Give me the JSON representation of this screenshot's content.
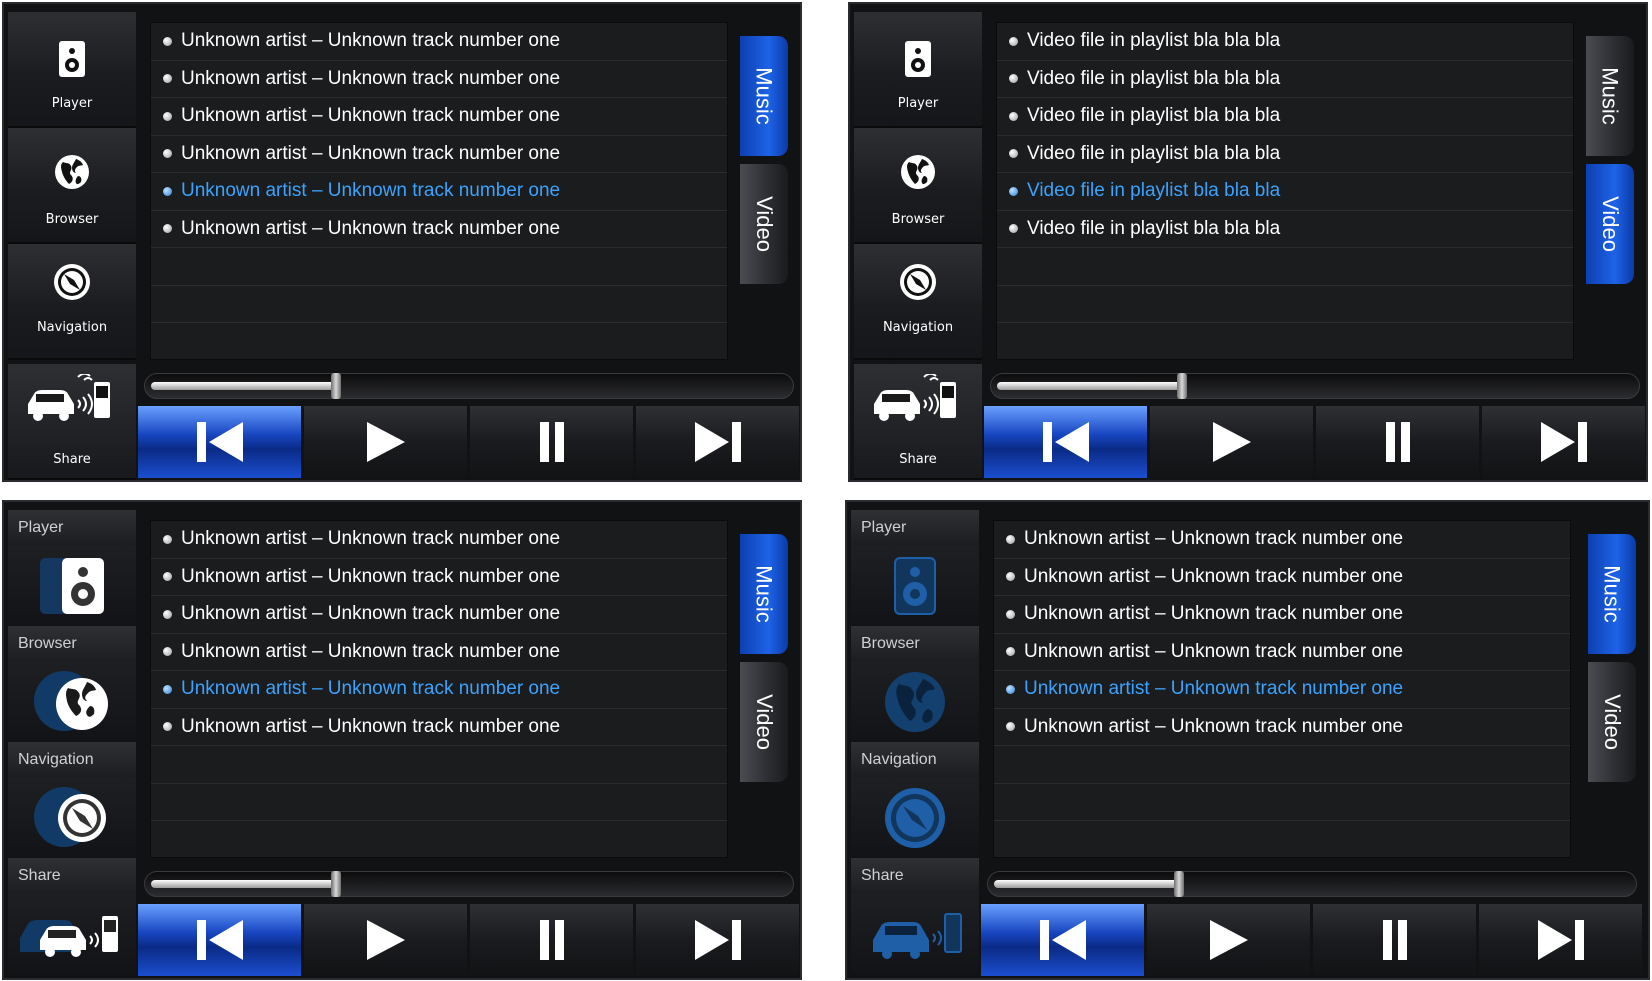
{
  "colors": {
    "accent": "#1e63e8",
    "highlight_text": "#3aa3ff",
    "background": "#111214"
  },
  "panels": [
    {
      "style": 1,
      "sidebar": {
        "player_label": "Player",
        "browser_label": "Browser",
        "navigation_label": "Navigation",
        "share_label": "Share"
      },
      "list": [
        "Unknown artist – Unknown track number one",
        "Unknown artist – Unknown track number one",
        "Unknown artist – Unknown track number one",
        "Unknown artist – Unknown track number one",
        "Unknown artist – Unknown track number one",
        "Unknown artist – Unknown track number one"
      ],
      "selected_index": 4,
      "tabs": {
        "music": "Music",
        "video": "Video",
        "active": "music"
      },
      "progress": 0.32
    },
    {
      "style": 1,
      "sidebar": {
        "player_label": "Player",
        "browser_label": "Browser",
        "navigation_label": "Navigation",
        "share_label": "Share"
      },
      "list": [
        "Video file in playlist bla bla bla",
        "Video file in playlist bla bla bla",
        "Video file in playlist bla bla bla",
        "Video file in playlist bla bla bla",
        "Video file in playlist bla bla bla",
        "Video file in playlist bla bla bla"
      ],
      "selected_index": 4,
      "tabs": {
        "music": "Music",
        "video": "Video",
        "active": "video"
      },
      "progress": 0.32
    },
    {
      "style": 2,
      "sidebar": {
        "player_label": "Player",
        "browser_label": "Browser",
        "navigation_label": "Navigation",
        "share_label": "Share"
      },
      "list": [
        "Unknown artist – Unknown track number one",
        "Unknown artist – Unknown track number one",
        "Unknown artist – Unknown track number one",
        "Unknown artist – Unknown track number one",
        "Unknown artist – Unknown track number one",
        "Unknown artist – Unknown track number one"
      ],
      "selected_index": 4,
      "tabs": {
        "music": "Music",
        "video": "Video",
        "active": "music"
      },
      "progress": 0.32
    },
    {
      "style": 3,
      "sidebar": {
        "player_label": "Player",
        "browser_label": "Browser",
        "navigation_label": "Navigation",
        "share_label": "Share"
      },
      "list": [
        "Unknown artist – Unknown track number one",
        "Unknown artist – Unknown track number one",
        "Unknown artist – Unknown track number one",
        "Unknown artist – Unknown track number one",
        "Unknown artist – Unknown track number one",
        "Unknown artist – Unknown track number one"
      ],
      "selected_index": 4,
      "tabs": {
        "music": "Music",
        "video": "Video",
        "active": "music"
      },
      "progress": 0.32
    }
  ],
  "controls": {
    "icons": [
      "skip-back-icon",
      "play-icon",
      "pause-icon",
      "skip-forward-icon"
    ],
    "active_index": 0
  }
}
